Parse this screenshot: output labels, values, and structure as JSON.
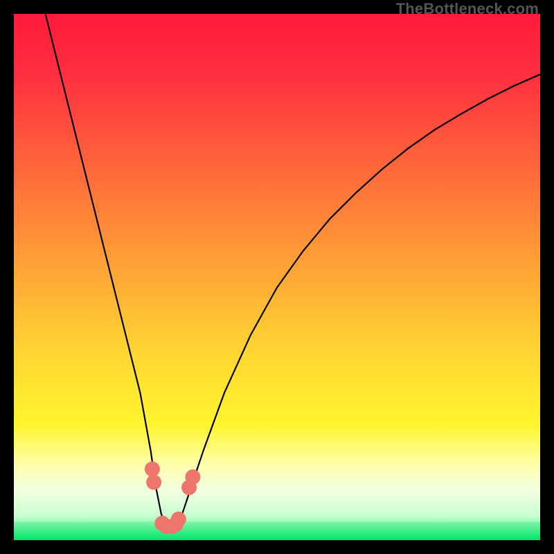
{
  "watermark": "TheBottleneck.com",
  "chart_data": {
    "type": "line",
    "title": "",
    "xlabel": "",
    "ylabel": "",
    "xlim": [
      0,
      100
    ],
    "ylim": [
      0,
      100
    ],
    "series": [
      {
        "name": "bottleneck-curve",
        "x": [
          6,
          8,
          10,
          12,
          14,
          16,
          18,
          20,
          22,
          24,
          26,
          27,
          28,
          29,
          30,
          31,
          32,
          34,
          36,
          40,
          45,
          50,
          55,
          60,
          65,
          70,
          75,
          80,
          85,
          90,
          95,
          100
        ],
        "y": [
          100,
          92,
          84,
          76,
          68,
          60,
          52,
          44,
          36,
          28,
          17,
          10,
          5,
          2.5,
          2.5,
          3,
          5,
          11,
          17,
          28,
          39,
          48,
          55,
          61,
          66,
          70.5,
          74.5,
          78,
          81,
          83.8,
          86.3,
          88.5
        ]
      }
    ],
    "green_band": {
      "y_start": 0,
      "y_end": 3.5
    },
    "markers": [
      {
        "name": "left-cluster",
        "x": 26.6,
        "y": 11
      },
      {
        "name": "left-cluster",
        "x": 26.3,
        "y": 13.5
      },
      {
        "name": "right-cluster",
        "x": 33.3,
        "y": 10
      },
      {
        "name": "right-cluster",
        "x": 34.0,
        "y": 12
      },
      {
        "name": "bottom-cluster",
        "x": 28.2,
        "y": 3.2
      },
      {
        "name": "bottom-cluster",
        "x": 29.0,
        "y": 2.6
      },
      {
        "name": "bottom-cluster",
        "x": 30.0,
        "y": 2.6
      },
      {
        "name": "bottom-cluster",
        "x": 30.8,
        "y": 3.0
      },
      {
        "name": "bottom-cluster",
        "x": 31.3,
        "y": 4.0
      }
    ],
    "gradient_stops": [
      {
        "offset": 0.0,
        "color": "#ff1a3a"
      },
      {
        "offset": 0.12,
        "color": "#ff3040"
      },
      {
        "offset": 0.3,
        "color": "#ff6a3a"
      },
      {
        "offset": 0.48,
        "color": "#ffa236"
      },
      {
        "offset": 0.63,
        "color": "#ffd233"
      },
      {
        "offset": 0.78,
        "color": "#fff52e"
      },
      {
        "offset": 0.86,
        "color": "#fdffb0"
      },
      {
        "offset": 0.905,
        "color": "#f3ffe0"
      },
      {
        "offset": 0.955,
        "color": "#c8ffd0"
      },
      {
        "offset": 1.0,
        "color": "#00e86e"
      }
    ],
    "marker_color": "#ed776c",
    "curve_color": "#000000"
  }
}
